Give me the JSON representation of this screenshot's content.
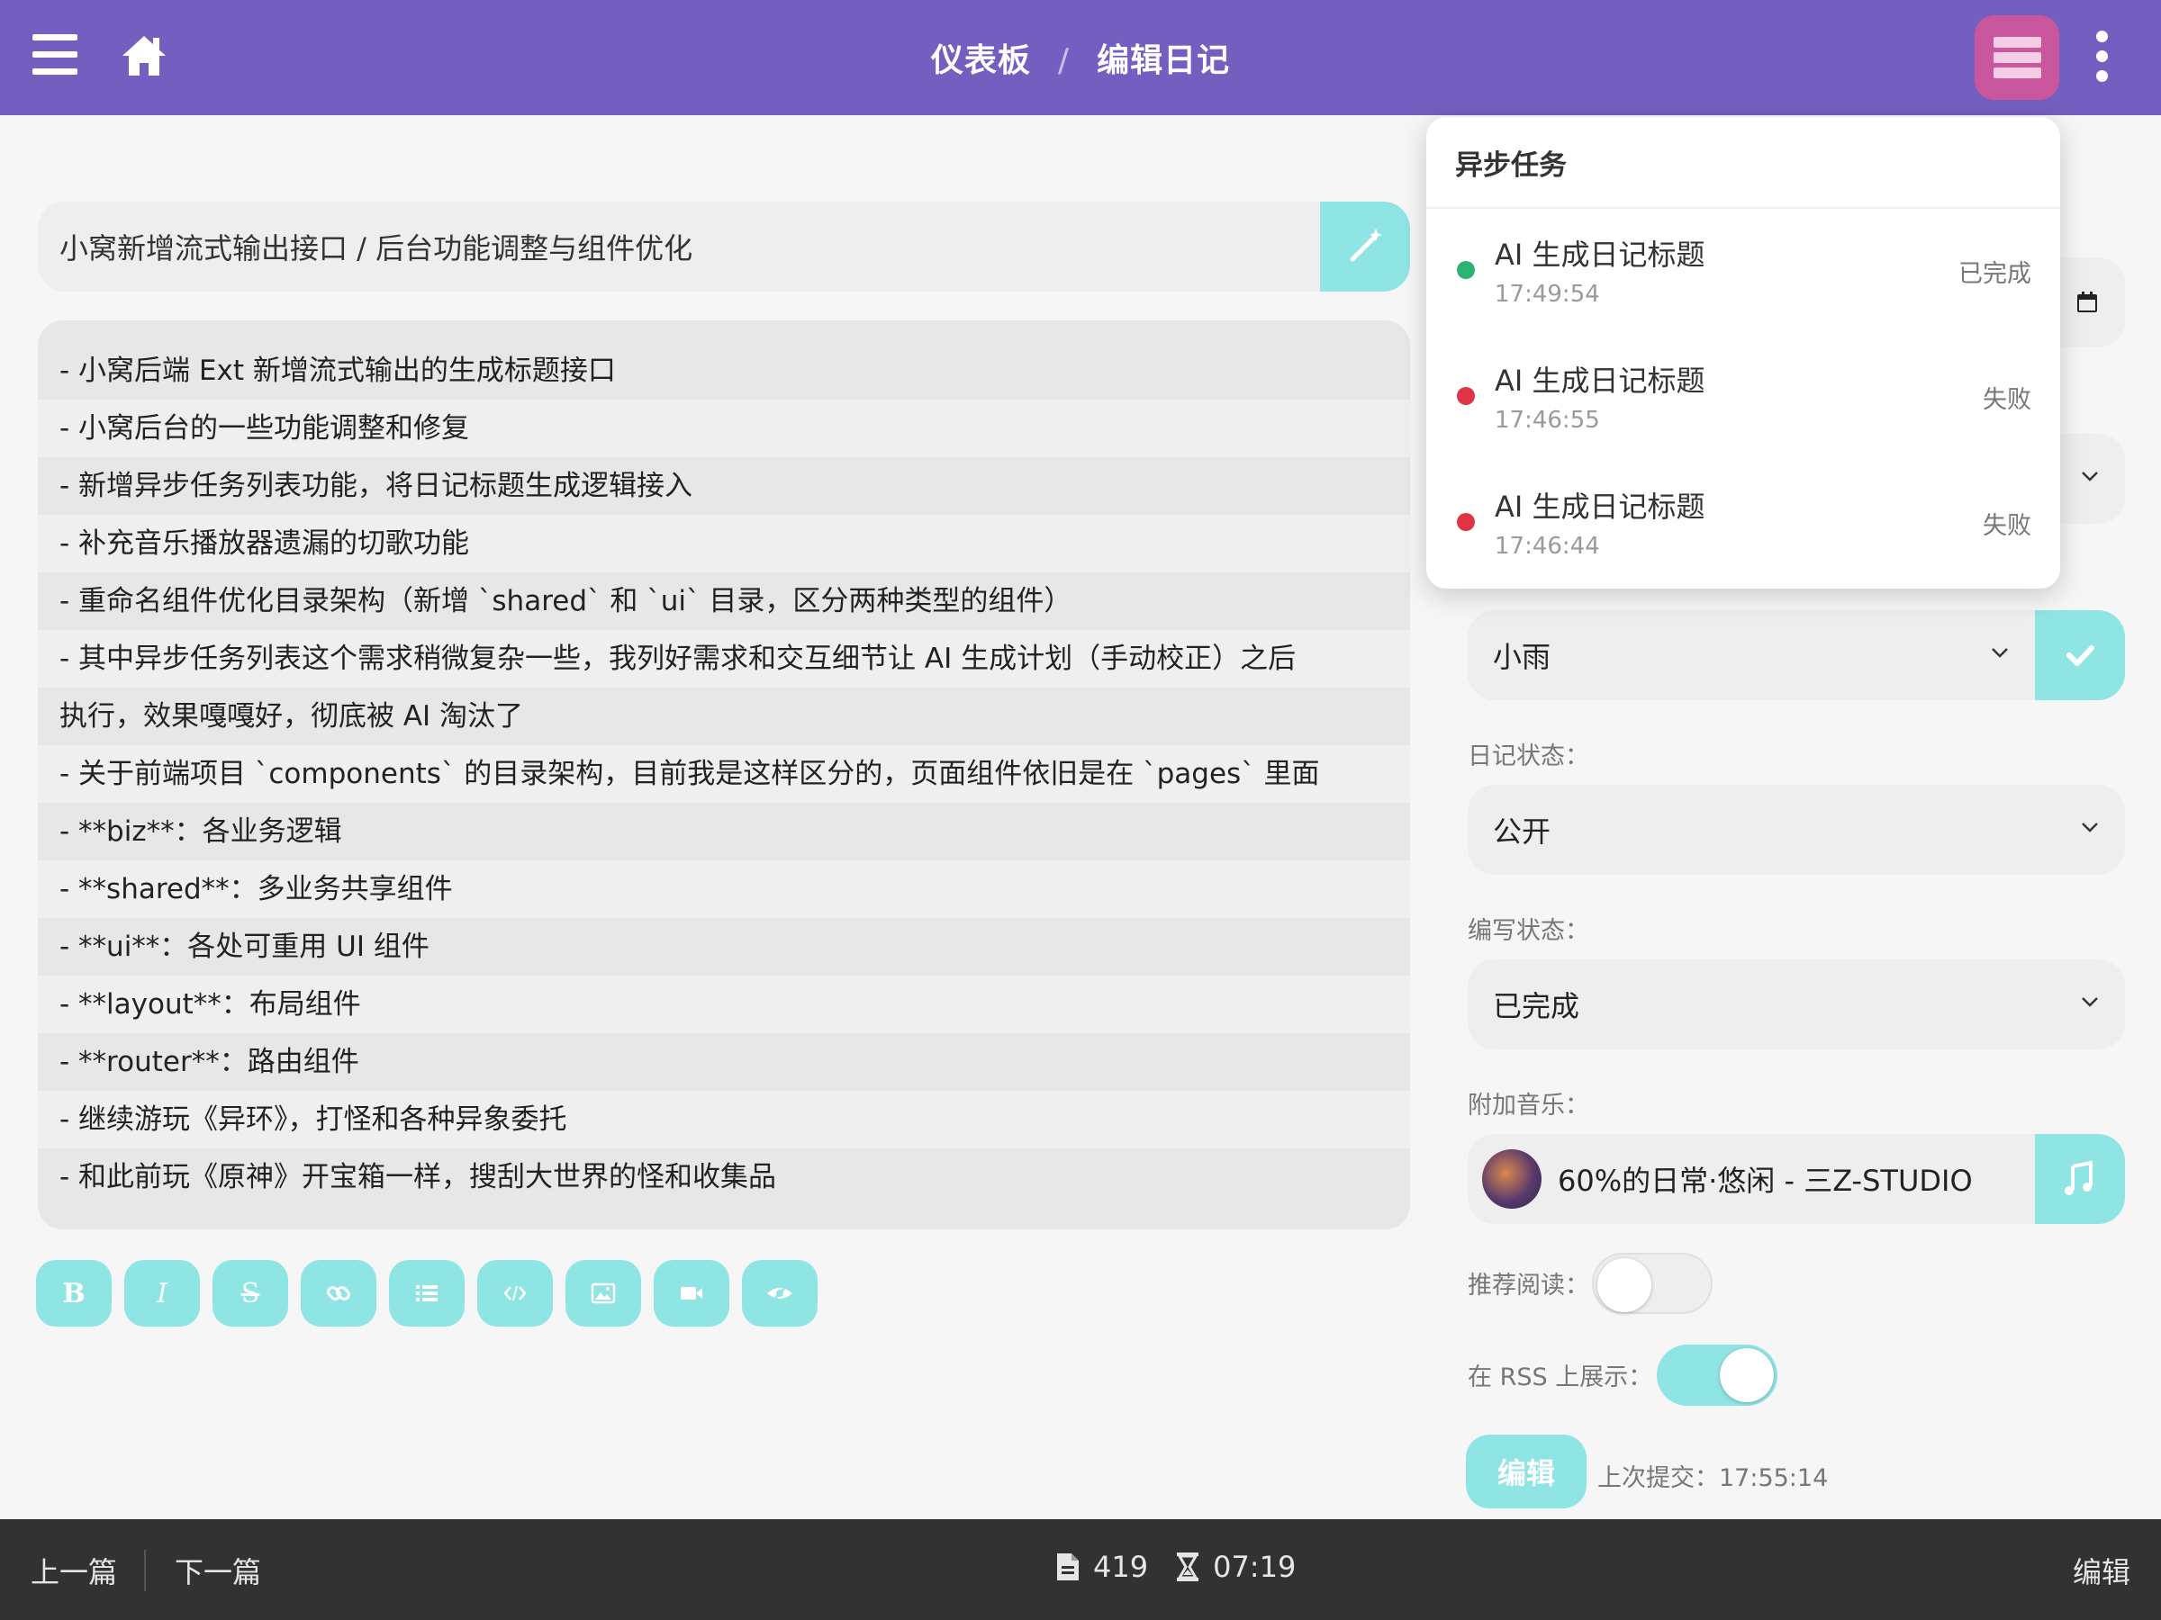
{
  "header": {
    "breadcrumb": [
      "仪表板",
      "编辑日记"
    ],
    "separator": "/"
  },
  "editor": {
    "title": "小窝新增流式输出接口 / 后台功能调整与组件优化",
    "lines": [
      "- 小窝后端 Ext 新增流式输出的生成标题接口",
      "- 小窝后台的一些功能调整和修复",
      "  - 新增异步任务列表功能，将日记标题生成逻辑接入",
      "  - 补充音乐播放器遗漏的切歌功能",
      "  - 重命名组件优化目录架构（新增 `shared` 和 `ui` 目录，区分两种类型的组件）",
      "  - 其中异步任务列表这个需求稍微复杂一些，我列好需求和交互细节让 AI 生成计划（手动校正）之后",
      "执行，效果嘎嘎好，彻底被 AI 淘汰了",
      "- 关于前端项目 `components` 的目录架构，目前我是这样区分的，页面组件依旧是在 `pages` 里面",
      "  - **biz**：各业务逻辑",
      "  - **shared**：多业务共享组件",
      "  - **ui**：各处可重用 UI 组件",
      "  - **layout**：布局组件",
      "  - **router**：路由组件",
      "- 继续游玩《异环》，打怪和各种异象委托",
      "  - 和此前玩《原神》开宝箱一样，搜刮大世界的怪和收集品"
    ],
    "toolbar": [
      "bold",
      "italic",
      "strikethrough",
      "link",
      "list",
      "code",
      "image",
      "video",
      "preview"
    ]
  },
  "sidebar": {
    "weather": "小雨",
    "diary_status_label": "日记状态：",
    "diary_status": "公开",
    "writing_status_label": "编写状态：",
    "writing_status": "已完成",
    "music_label": "附加音乐：",
    "music": "60%的日常·悠闲 - 三Z-STUDIO",
    "recommend_label": "推荐阅读：",
    "recommend_on": false,
    "rss_label": "在 RSS 上展示：",
    "rss_on": true,
    "edit_button": "编辑",
    "last_submit": "上次提交：17:55:14"
  },
  "tasks": {
    "title": "异步任务",
    "items": [
      {
        "name": "AI 生成日记标题",
        "time": "17:49:54",
        "status": "已完成",
        "color": "#2db371"
      },
      {
        "name": "AI 生成日记标题",
        "time": "17:46:55",
        "status": "失败",
        "color": "#e03344"
      },
      {
        "name": "AI 生成日记标题",
        "time": "17:46:44",
        "status": "失败",
        "color": "#e03344"
      }
    ]
  },
  "footer": {
    "prev": "上一篇",
    "next": "下一篇",
    "word_count": "419",
    "read_time": "07:19",
    "edit": "编辑"
  },
  "colors": {
    "primary": "#735fbf",
    "accent": "#8fe5e4",
    "tasks_button": "#c8579d",
    "footer": "#323232"
  }
}
